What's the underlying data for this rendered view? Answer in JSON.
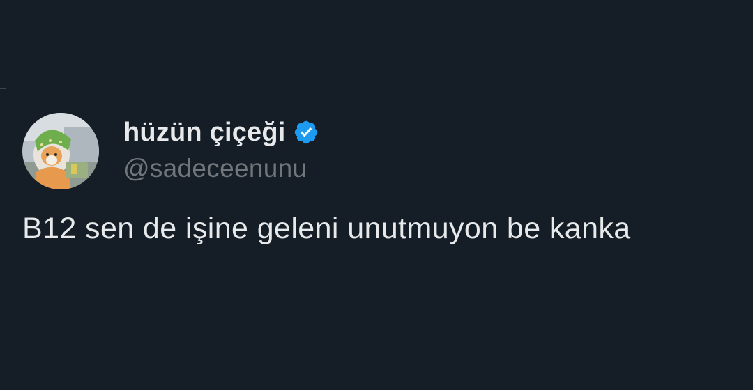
{
  "tweet": {
    "author": {
      "display_name": "hüzün çiçeği",
      "handle": "@sadeceenunu",
      "verified": true,
      "verified_icon": "verified-badge-icon",
      "avatar_icon": "cat-with-headscarf-avatar"
    },
    "text": "B12 sen de işine geleni unutmuyon be kanka"
  },
  "colors": {
    "background": "#151d27",
    "primary_text": "#e7e9ea",
    "secondary_text": "#71767b",
    "verified_blue": "#1d9bf0"
  }
}
